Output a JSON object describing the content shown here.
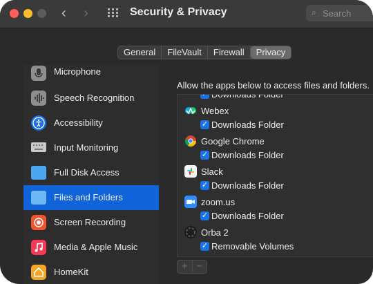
{
  "window": {
    "title": "Security & Privacy"
  },
  "search": {
    "placeholder": "Search"
  },
  "tabs": [
    "General",
    "FileVault",
    "Firewall",
    "Privacy"
  ],
  "active_tab": "Privacy",
  "sidebar": {
    "items": [
      {
        "label": "Microphone",
        "icon": "microphone-icon",
        "color": "#8e8e90"
      },
      {
        "label": "Speech Recognition",
        "icon": "waveform-icon",
        "color": "#8e8e90"
      },
      {
        "label": "Accessibility",
        "icon": "accessibility-icon",
        "color": "#1a73e8"
      },
      {
        "label": "Input Monitoring",
        "icon": "keyboard-icon",
        "color": "#c8c8c8"
      },
      {
        "label": "Full Disk Access",
        "icon": "folder-icon",
        "color": "#4aa8f0"
      },
      {
        "label": "Files and Folders",
        "icon": "folder-icon",
        "color": "#6db8f5"
      },
      {
        "label": "Screen Recording",
        "icon": "record-icon",
        "color": "#f0552f"
      },
      {
        "label": "Media & Apple Music",
        "icon": "music-icon",
        "color": "#f33a55"
      },
      {
        "label": "HomeKit",
        "icon": "home-icon",
        "color": "#f5a623"
      }
    ],
    "selected": "Files and Folders"
  },
  "content": {
    "header": "Allow the apps below to access files and folders.",
    "entries": [
      {
        "kind": "check",
        "label": "Downloads Folder",
        "checked": true
      },
      {
        "kind": "app",
        "name": "Webex",
        "icon": "webex-icon"
      },
      {
        "kind": "check",
        "label": "Downloads Folder",
        "checked": true
      },
      {
        "kind": "app",
        "name": "Google Chrome",
        "icon": "chrome-icon"
      },
      {
        "kind": "check",
        "label": "Downloads Folder",
        "checked": true
      },
      {
        "kind": "app",
        "name": "Slack",
        "icon": "slack-icon"
      },
      {
        "kind": "check",
        "label": "Downloads Folder",
        "checked": true
      },
      {
        "kind": "app",
        "name": "zoom.us",
        "icon": "zoom-icon"
      },
      {
        "kind": "check",
        "label": "Downloads Folder",
        "checked": true
      },
      {
        "kind": "app",
        "name": "Orba 2",
        "icon": "orba-icon"
      },
      {
        "kind": "check",
        "label": "Removable Volumes",
        "checked": true
      }
    ]
  },
  "buttons": {
    "add": "+",
    "remove": "−"
  },
  "colors": {
    "accent": "#1063d9",
    "checkbox": "#1a73e8"
  }
}
